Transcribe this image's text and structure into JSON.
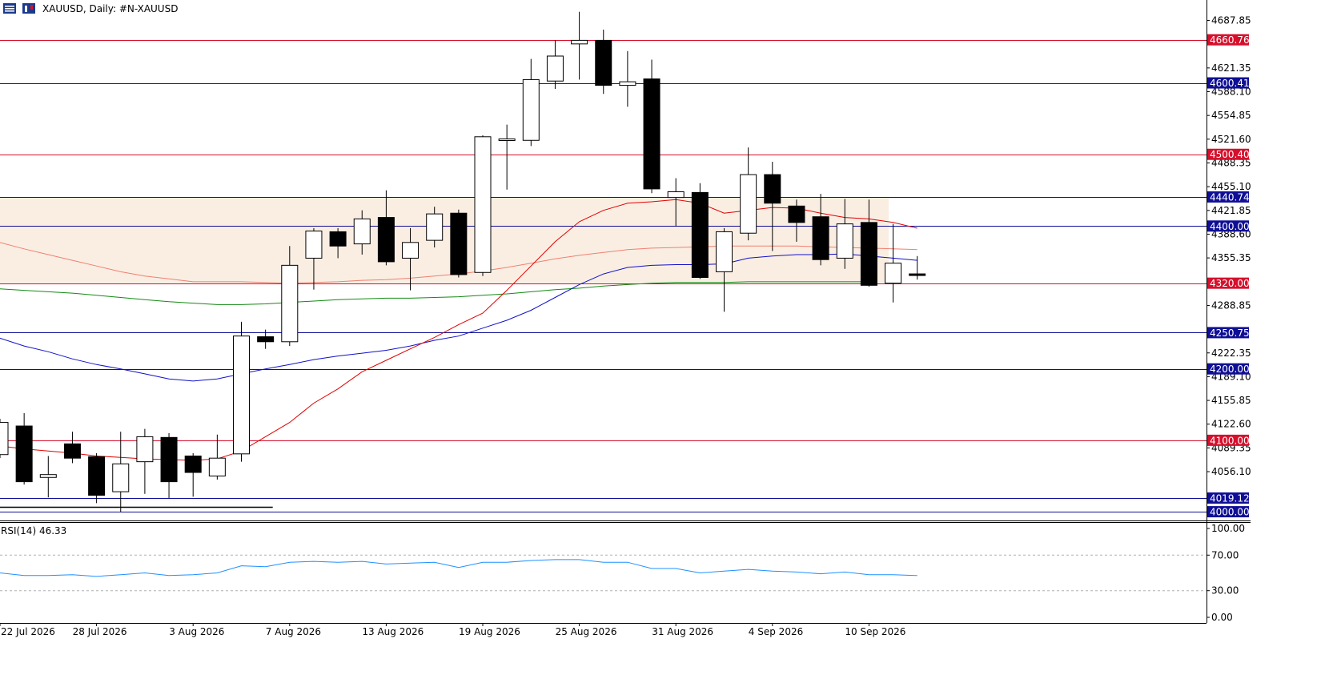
{
  "header": {
    "title": "XAUUSD, Daily:  #N-XAUUSD",
    "icons": [
      "chart-list-icon",
      "candle-chart-icon"
    ]
  },
  "chart_data": {
    "type": "candlestick",
    "symbol": "XAUUSD",
    "timeframe": "Daily",
    "ylim": [
      3990,
      4712
    ],
    "y_ticks": [
      "4687.85",
      "4621.35",
      "4588.10",
      "4554.85",
      "4521.60",
      "4488.35",
      "4455.10",
      "4421.85",
      "4388.60",
      "4355.35",
      "4288.85",
      "4222.35",
      "4189.10",
      "4155.85",
      "4122.60",
      "4089.35",
      "4056.10"
    ],
    "x_labels": [
      {
        "i": 0,
        "label": "22 Jul 2026"
      },
      {
        "i": 4,
        "label": "28 Jul 2026"
      },
      {
        "i": 8,
        "label": "3 Aug 2026"
      },
      {
        "i": 12,
        "label": "7 Aug 2026"
      },
      {
        "i": 16,
        "label": "13 Aug 2026"
      },
      {
        "i": 20,
        "label": "19 Aug 2026"
      },
      {
        "i": 24,
        "label": "25 Aug 2026"
      },
      {
        "i": 28,
        "label": "31 Aug 2026"
      },
      {
        "i": 32,
        "label": "4 Sep 2026"
      },
      {
        "i": 36,
        "label": "10 Sep 2026"
      }
    ],
    "candles": [
      {
        "o": 4080,
        "h": 4130,
        "l": 4075,
        "c": 4125
      },
      {
        "o": 4120,
        "h": 4138,
        "l": 4038,
        "c": 4042
      },
      {
        "o": 4048,
        "h": 4078,
        "l": 4020,
        "c": 4052
      },
      {
        "o": 4095,
        "h": 4112,
        "l": 4068,
        "c": 4075
      },
      {
        "o": 4077,
        "h": 4082,
        "l": 4012,
        "c": 4023
      },
      {
        "o": 4028,
        "h": 4112,
        "l": 4000,
        "c": 4067
      },
      {
        "o": 4070,
        "h": 4116,
        "l": 4025,
        "c": 4105
      },
      {
        "o": 4104,
        "h": 4110,
        "l": 4019,
        "c": 4042
      },
      {
        "o": 4078,
        "h": 4082,
        "l": 4021,
        "c": 4055
      },
      {
        "o": 4050,
        "h": 4108,
        "l": 4045,
        "c": 4075
      },
      {
        "o": 4081,
        "h": 4266,
        "l": 4070,
        "c": 4246
      },
      {
        "o": 4245,
        "h": 4255,
        "l": 4228,
        "c": 4238
      },
      {
        "o": 4238,
        "h": 4372,
        "l": 4232,
        "c": 4345
      },
      {
        "o": 4355,
        "h": 4397,
        "l": 4311,
        "c": 4393
      },
      {
        "o": 4392,
        "h": 4397,
        "l": 4355,
        "c": 4372
      },
      {
        "o": 4375,
        "h": 4422,
        "l": 4360,
        "c": 4410
      },
      {
        "o": 4412,
        "h": 4450,
        "l": 4345,
        "c": 4350
      },
      {
        "o": 4355,
        "h": 4397,
        "l": 4310,
        "c": 4377
      },
      {
        "o": 4380,
        "h": 4427,
        "l": 4370,
        "c": 4417
      },
      {
        "o": 4418,
        "h": 4423,
        "l": 4328,
        "c": 4332
      },
      {
        "o": 4335,
        "h": 4527,
        "l": 4330,
        "c": 4525
      },
      {
        "o": 4522,
        "h": 4542,
        "l": 4451,
        "c": 4522
      },
      {
        "o": 4520,
        "h": 4634,
        "l": 4512,
        "c": 4605
      },
      {
        "o": 4603,
        "h": 4660,
        "l": 4592,
        "c": 4638
      },
      {
        "o": 4655,
        "h": 4700,
        "l": 4605,
        "c": 4660
      },
      {
        "o": 4660,
        "h": 4675,
        "l": 4585,
        "c": 4597
      },
      {
        "o": 4597,
        "h": 4645,
        "l": 4567,
        "c": 4602
      },
      {
        "o": 4606,
        "h": 4633,
        "l": 4446,
        "c": 4452
      },
      {
        "o": 4440,
        "h": 4467,
        "l": 4400,
        "c": 4448
      },
      {
        "o": 4447,
        "h": 4460,
        "l": 4326,
        "c": 4328
      },
      {
        "o": 4336,
        "h": 4397,
        "l": 4280,
        "c": 4392
      },
      {
        "o": 4390,
        "h": 4510,
        "l": 4380,
        "c": 4472
      },
      {
        "o": 4472,
        "h": 4490,
        "l": 4365,
        "c": 4432
      },
      {
        "o": 4428,
        "h": 4437,
        "l": 4378,
        "c": 4405
      },
      {
        "o": 4413,
        "h": 4445,
        "l": 4345,
        "c": 4353
      },
      {
        "o": 4355,
        "h": 4438,
        "l": 4340,
        "c": 4403
      },
      {
        "o": 4405,
        "h": 4437,
        "l": 4315,
        "c": 4317
      },
      {
        "o": 4320,
        "h": 4403,
        "l": 4293,
        "c": 4348
      },
      {
        "o": 4333,
        "h": 4358,
        "l": 4325,
        "c": 4332
      }
    ],
    "ma_red": [
      4092,
      4088,
      4085,
      4082,
      4078,
      4076,
      4074,
      4073,
      4072,
      4074,
      4085,
      4105,
      4125,
      4152,
      4172,
      4196,
      4212,
      4228,
      4244,
      4262,
      4278,
      4310,
      4344,
      4378,
      4406,
      4422,
      4432,
      4434,
      4437,
      4432,
      4418,
      4422,
      4426,
      4425,
      4418,
      4412,
      4410,
      4405,
      4397
    ],
    "ma_blue": [
      4243,
      4232,
      4224,
      4214,
      4206,
      4200,
      4193,
      4186,
      4183,
      4186,
      4193,
      4200,
      4206,
      4213,
      4218,
      4222,
      4226,
      4232,
      4240,
      4246,
      4257,
      4268,
      4282,
      4300,
      4318,
      4333,
      4342,
      4345,
      4346,
      4346,
      4347,
      4355,
      4358,
      4360,
      4360,
      4361,
      4358,
      4355,
      4352
    ],
    "ma_salmon": [
      4377,
      4368,
      4360,
      4352,
      4344,
      4336,
      4330,
      4326,
      4322,
      4322,
      4322,
      4321,
      4320,
      4321,
      4322,
      4324,
      4325,
      4327,
      4330,
      4333,
      4337,
      4342,
      4348,
      4354,
      4359,
      4363,
      4367,
      4369,
      4370,
      4371,
      4372,
      4372,
      4372,
      4372,
      4371,
      4370,
      4369,
      4368,
      4367
    ],
    "ma_green": [
      4312,
      4310,
      4308,
      4306,
      4303,
      4300,
      4297,
      4294,
      4292,
      4290,
      4290,
      4291,
      4293,
      4295,
      4297,
      4298,
      4299,
      4299,
      4300,
      4301,
      4303,
      4305,
      4308,
      4311,
      4313,
      4316,
      4318,
      4320,
      4321,
      4321,
      4321,
      4322,
      4322,
      4322,
      4322,
      4322,
      4322
    ],
    "levels": [
      {
        "value": 4660.76,
        "label": "4660.76",
        "color": "#d6102c"
      },
      {
        "value": 4600.41,
        "label": "4600.41",
        "color": "#0f0f96"
      },
      {
        "value": 4500.4,
        "label": "4500.40",
        "color": "#d6102c"
      },
      {
        "value": 4440.74,
        "label": "4440.74",
        "color": "#0f0f96"
      },
      {
        "value": 4400.0,
        "label": "4400.00",
        "color": "#0f0f96"
      },
      {
        "value": 4320.0,
        "label": "4320.00",
        "color": "#d6102c"
      },
      {
        "value": 4250.75,
        "label": "4250.75",
        "color": "#0f0f96"
      },
      {
        "value": 4200.0,
        "label": "4200.00",
        "color": "#0f0f96"
      },
      {
        "value": 4100.0,
        "label": "4100.00",
        "color": "#d6102c"
      },
      {
        "value": 4019.12,
        "label": "4019.12",
        "color": "#0f0f96"
      },
      {
        "value": 4000.0,
        "label": "4000.00",
        "color": "#0f0f96"
      }
    ],
    "zone": {
      "from": 4320,
      "to": 4440,
      "color": "#faeee3"
    },
    "support_segment": {
      "value": 4007,
      "from_i": 0,
      "to_i": 11.3
    },
    "colors": {
      "ma_red": "#e00000",
      "ma_blue": "#1010c8",
      "ma_salmon": "#f08070",
      "ma_green": "#138a13",
      "rsi": "#1e90ff"
    }
  },
  "rsi": {
    "label": "RSI(14) 46.33",
    "ylim": [
      0,
      100
    ],
    "ticks": [
      "100.00",
      "70.00",
      "30.00",
      "0.00"
    ],
    "levels": [
      70,
      30
    ],
    "values": [
      50,
      47,
      47,
      48,
      46,
      48,
      50,
      47,
      48,
      50,
      58,
      57,
      62,
      63,
      62,
      63,
      60,
      61,
      62,
      56,
      62,
      62,
      64,
      65,
      65,
      62,
      62,
      55,
      55,
      50,
      52,
      54,
      52,
      51,
      49,
      51,
      48,
      48,
      47
    ]
  }
}
